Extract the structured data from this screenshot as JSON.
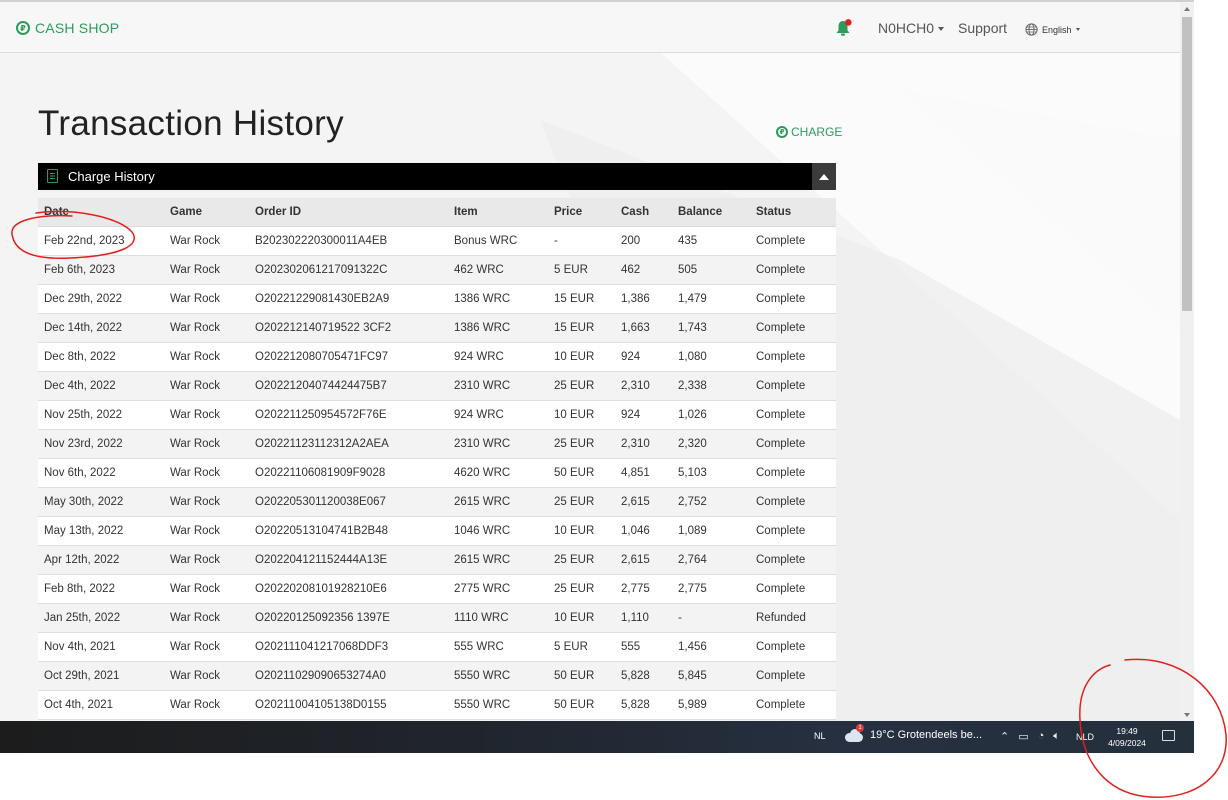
{
  "navbar": {
    "brand": "CASH SHOP",
    "username": "N0HCH0",
    "support": "Support",
    "language": "English"
  },
  "page": {
    "title": "Transaction History",
    "charge_link": "CHARGE"
  },
  "panel": {
    "title": "Charge History"
  },
  "table": {
    "columns": [
      "Date",
      "Game",
      "Order ID",
      "Item",
      "Price",
      "Cash",
      "Balance",
      "Status"
    ],
    "rows": [
      [
        "Feb 22nd, 2023",
        "War Rock",
        "B202302220300011A4EB",
        "Bonus WRC",
        "-",
        "200",
        "435",
        "Complete"
      ],
      [
        "Feb 6th, 2023",
        "War Rock",
        "O202302061217091322C",
        "462 WRC",
        "5 EUR",
        "462",
        "505",
        "Complete"
      ],
      [
        "Dec 29th, 2022",
        "War Rock",
        "O20221229081430EB2A9",
        "1386 WRC",
        "15 EUR",
        "1,386",
        "1,479",
        "Complete"
      ],
      [
        "Dec 14th, 2022",
        "War Rock",
        "O202212140719522 3CF2",
        "1386 WRC",
        "15 EUR",
        "1,663",
        "1,743",
        "Complete"
      ],
      [
        "Dec 8th, 2022",
        "War Rock",
        "O202212080705471FC97",
        "924 WRC",
        "10 EUR",
        "924",
        "1,080",
        "Complete"
      ],
      [
        "Dec 4th, 2022",
        "War Rock",
        "O20221204074424475B7",
        "2310 WRC",
        "25 EUR",
        "2,310",
        "2,338",
        "Complete"
      ],
      [
        "Nov 25th, 2022",
        "War Rock",
        "O202211250954572F76E",
        "924 WRC",
        "10 EUR",
        "924",
        "1,026",
        "Complete"
      ],
      [
        "Nov 23rd, 2022",
        "War Rock",
        "O20221123112312A2AEA",
        "2310 WRC",
        "25 EUR",
        "2,310",
        "2,320",
        "Complete"
      ],
      [
        "Nov 6th, 2022",
        "War Rock",
        "O20221106081909F9028",
        "4620 WRC",
        "50 EUR",
        "4,851",
        "5,103",
        "Complete"
      ],
      [
        "May 30th, 2022",
        "War Rock",
        "O202205301120038E067",
        "2615 WRC",
        "25 EUR",
        "2,615",
        "2,752",
        "Complete"
      ],
      [
        "May 13th, 2022",
        "War Rock",
        "O20220513104741B2B48",
        "1046 WRC",
        "10 EUR",
        "1,046",
        "1,089",
        "Complete"
      ],
      [
        "Apr 12th, 2022",
        "War Rock",
        "O202204121152444A13E",
        "2615 WRC",
        "25 EUR",
        "2,615",
        "2,764",
        "Complete"
      ],
      [
        "Feb 8th, 2022",
        "War Rock",
        "O20220208101928210E6",
        "2775 WRC",
        "25 EUR",
        "2,775",
        "2,775",
        "Complete"
      ],
      [
        "Jan 25th, 2022",
        "War Rock",
        "O20220125092356 1397E",
        "1110 WRC",
        "10 EUR",
        "1,110",
        "-",
        "Refunded"
      ],
      [
        "Nov 4th, 2021",
        "War Rock",
        "O202111041217068DDF3",
        "555 WRC",
        "5 EUR",
        "555",
        "1,456",
        "Complete"
      ],
      [
        "Oct 29th, 2021",
        "War Rock",
        "O20211029090653274A0",
        "5550 WRC",
        "50 EUR",
        "5,828",
        "5,845",
        "Complete"
      ],
      [
        "Oct 4th, 2021",
        "War Rock",
        "O20211004105138D0155",
        "5550 WRC",
        "50 EUR",
        "5,828",
        "5,989",
        "Complete"
      ]
    ]
  },
  "taskbar": {
    "input_lang": "NL",
    "weather_badge": "1",
    "weather": "19°C  Grotendeels be...",
    "keyboard": "NLD",
    "time": "19:49",
    "date": "4/09/2024"
  },
  "colors": {
    "accent_green": "#2e9b5a",
    "panel_header": "#000000",
    "annotation_red": "#e0201e"
  },
  "icons": {
    "brand": "coin-icon",
    "notifications": "bell-icon",
    "language": "globe-icon",
    "panel": "document-icon",
    "collapse": "chevron-up-icon",
    "weather": "cloud-icon",
    "notification_center": "chat-bubble-icon"
  }
}
